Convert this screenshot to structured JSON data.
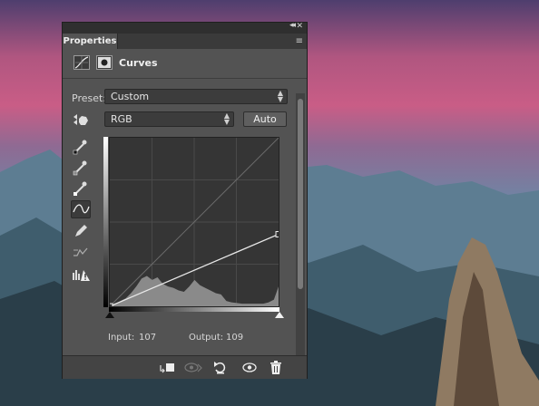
{
  "panel": {
    "tab_label": "Properties",
    "collapse_glyph": "◂◂",
    "close_glyph": "✕",
    "menu_glyph": "≡",
    "adjustment_title": "Curves"
  },
  "preset": {
    "label": "Preset:",
    "value": "Custom"
  },
  "channel": {
    "value": "RGB"
  },
  "auto_button": "Auto",
  "readout": {
    "input_label": "Input:",
    "input_value": "107",
    "output_label": "Output:",
    "output_value": "109"
  },
  "icons": {
    "curves_adjustment": "curves-adjustment-icon",
    "layer_mask": "mask-icon",
    "targeted_adjust": "hand-adjust-icon",
    "eyedropper_black": "eyedropper-black-icon",
    "eyedropper_gray": "eyedropper-gray-icon",
    "eyedropper_white": "eyedropper-white-icon",
    "edit_points": "curve-points-icon",
    "draw_pencil": "pencil-icon",
    "smooth": "smooth-curve-icon",
    "clipping_warning": "clipping-warning-icon",
    "clip_to_layer": "clip-to-layer-icon",
    "view_previous": "view-previous-icon",
    "reset": "reset-icon",
    "visibility": "eye-icon",
    "delete": "trash-icon"
  },
  "chart_data": {
    "type": "area",
    "x": [
      0,
      8,
      16,
      24,
      32,
      40,
      48,
      56,
      64,
      72,
      80,
      88,
      96,
      104,
      112,
      120,
      128,
      136,
      144,
      152,
      160,
      168,
      176,
      184,
      192,
      200,
      208,
      216,
      224,
      232,
      240,
      248,
      255
    ],
    "values": [
      0,
      4,
      8,
      12,
      20,
      30,
      42,
      46,
      40,
      44,
      34,
      30,
      28,
      24,
      22,
      30,
      40,
      32,
      28,
      24,
      20,
      18,
      8,
      6,
      5,
      4,
      4,
      4,
      4,
      4,
      6,
      10,
      30
    ],
    "curve_points": [
      [
        0,
        0
      ],
      [
        255,
        109
      ]
    ],
    "xlim": [
      0,
      255
    ],
    "ylim": [
      0,
      255
    ],
    "grid": true
  },
  "colors": {
    "panel_bg": "#535353",
    "graph_bg": "#353535",
    "curve": "#e8e8e8"
  }
}
